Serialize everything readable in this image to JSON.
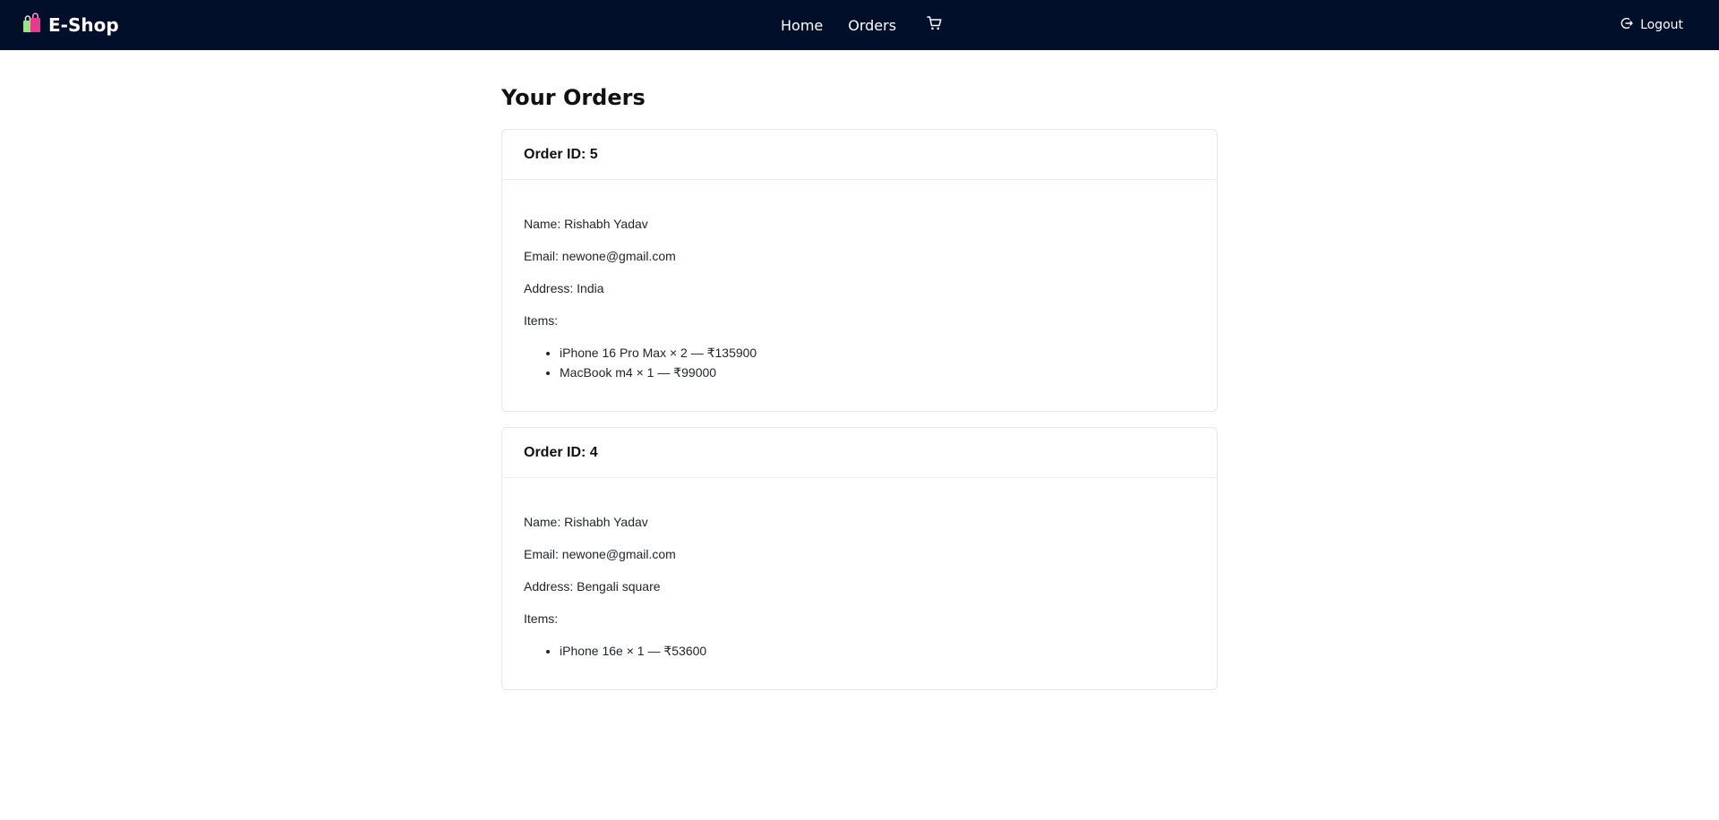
{
  "navbar": {
    "brand": "E-Shop",
    "brand_icon": "shopping-bags-icon",
    "links": [
      {
        "label": "Home"
      },
      {
        "label": "Orders"
      }
    ],
    "cart_icon": "cart-icon",
    "logout_label": "Logout",
    "logout_icon": "logout-icon",
    "bg_color": "#020f2b"
  },
  "page": {
    "title": "Your Orders"
  },
  "orders": [
    {
      "header": "Order ID: 5",
      "name": "Name: Rishabh Yadav",
      "email": "Email: newone@gmail.com",
      "address": "Address: India",
      "items_label": "Items:",
      "items": [
        "iPhone 16 Pro Max × 2 — ₹135900",
        "MacBook m4 × 1 — ₹99000"
      ]
    },
    {
      "header": "Order ID: 4",
      "name": "Name: Rishabh Yadav",
      "email": "Email: newone@gmail.com",
      "address": "Address: Bengali square",
      "items_label": "Items:",
      "items": [
        "iPhone 16e × 1 — ₹53600"
      ]
    }
  ]
}
